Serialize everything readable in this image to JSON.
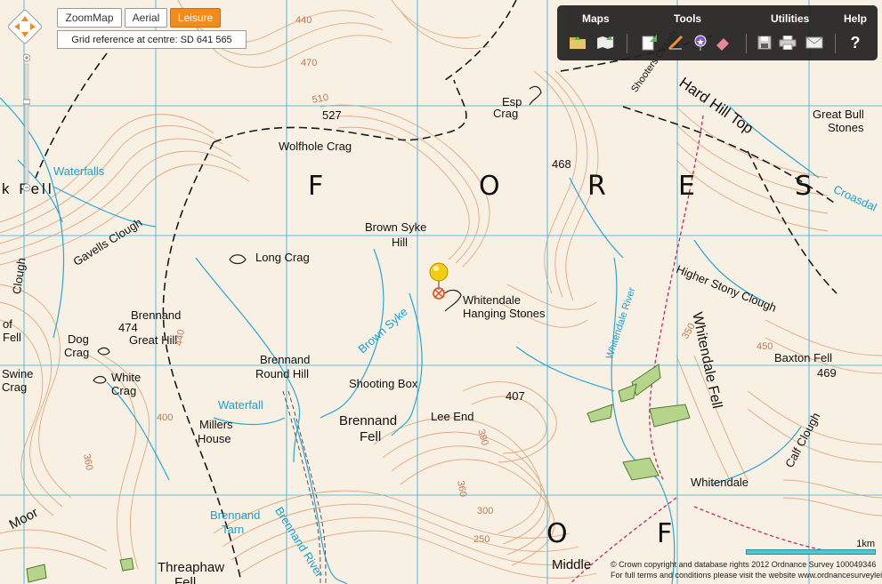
{
  "map_types": [
    {
      "label": "ZoomMap",
      "active": false
    },
    {
      "label": "Aerial",
      "active": false
    },
    {
      "label": "Leisure",
      "active": true
    }
  ],
  "grid_reference": "Grid reference at centre: SD 641 565",
  "toolbar": {
    "menus": [
      "Maps",
      "Tools",
      "Utilities",
      "Help"
    ],
    "help_icon": "?"
  },
  "map_labels": {
    "wolfhole_crag": "Wolfhole Crag",
    "spot_527": "527",
    "esp": "Esp",
    "crag": "Crag",
    "spot_468": "468",
    "forest_f": "F",
    "forest_o": "O",
    "forest_r": "R",
    "forest_e": "E",
    "forest_s": "S",
    "hard_hill_top": "Hard Hill Top",
    "shooters_clough": "Shooters Clough",
    "great_bull": "Great Bull",
    "stones": "Stones",
    "croasdale": "Croasdal",
    "waterfalls": "Waterfalls",
    "k_fell": "k  Fell",
    "gavells_clough": "Gavells Clough",
    "clough": "Clough",
    "long_crag": "Long Crag",
    "brown_syke": "Brown Syke",
    "hill": "Hill",
    "brown_syke_stream": "Brown Syke",
    "whitendale": "Whitendale",
    "hanging_stones": "Hanging Stones",
    "whitendale_river": "Whitendale River",
    "higher_stony_clough": "Higher Stony Clough",
    "whitendale_fell": "Whitendale Fell",
    "spot_450": "450",
    "baxton_fell": "Baxton Fell",
    "spot_469": "469",
    "calf_clough": "Calf Clough",
    "brennand": "Brennand",
    "spot_474": "474",
    "great_hill": "Great Hill",
    "dog": "Dog",
    "dog_crag": "Crag",
    "white": "White",
    "white_crag": "Crag",
    "swine": "Swine",
    "swine_crag": "Crag",
    "of_fell": "of",
    "fell_s": "Fell",
    "brennand_round": "Brennand",
    "round_hill": "Round Hill",
    "shooting_box": "Shooting Box",
    "spot_407": "407",
    "waterfall": "Waterfall",
    "brennand_fell": "Brennand",
    "fell": "Fell",
    "lee_end": "Lee End",
    "millers": "Millers",
    "house": "House",
    "whitendale_farm": "Whitendale",
    "moor": "Moor",
    "brennand_tarn": "Brennand",
    "tarn": "Tarn",
    "brennand_river": "Brennand River",
    "threaphaw": "Threaphaw",
    "threaphaw_fell": "Fell",
    "of_o": "O",
    "of_f": "F",
    "middle": "Middle",
    "contour_360": "360",
    "contour_390": "390",
    "contour_300": "300",
    "contour_250": "250",
    "contour_380": "380",
    "contour_400": "400",
    "contour_440": "440",
    "contour_350": "350",
    "contour_470": "470",
    "contour_140": "440",
    "contour_510": "510"
  },
  "scale_label": "1km",
  "copyright": "© Crown copyright and database rights 2012 Ordnance Survey 100049346",
  "terms": "For full terms and conditions please visit the website www.ordnancesurveyleisure.co.uk",
  "colors": {
    "map_background": "#f8f0e2",
    "grid": "#4fb9d6",
    "contour": "#e0a27a",
    "water": "#1aa0cf",
    "boundary": "#222222",
    "path": "#c8246a",
    "accent": "#f28a1c"
  }
}
